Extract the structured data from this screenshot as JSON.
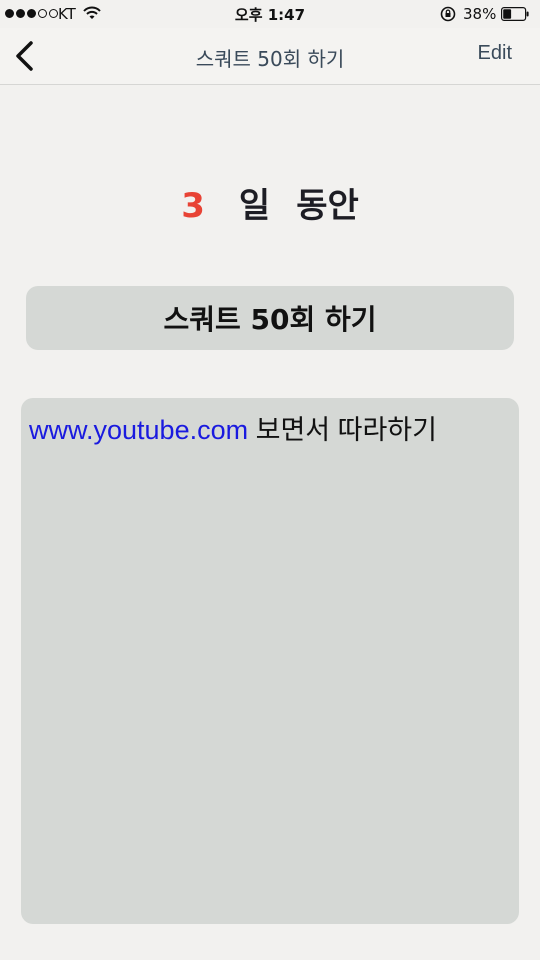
{
  "status_bar": {
    "carrier": "KT",
    "time": "오후 1:47",
    "battery": "38%",
    "battery_level": 0.38,
    "signal_bars_filled": 3,
    "signal_bars_total": 5
  },
  "nav": {
    "back_icon": "chevron-left-icon",
    "title": "스쿼트 50회 하기",
    "edit_label": "Edit"
  },
  "duration": {
    "days": "3",
    "unit": "일",
    "suffix": "동안"
  },
  "task": {
    "title": "스쿼트 50회 하기"
  },
  "memo": {
    "link": "www.youtube.com",
    "text": " 보면서 따라하기"
  },
  "colors": {
    "accent_red": "#e84335",
    "link_blue": "#1a1adf",
    "nav_text": "#3a4a5a",
    "card_bg": "#d5d8d5",
    "page_bg": "#f2f1ef"
  }
}
